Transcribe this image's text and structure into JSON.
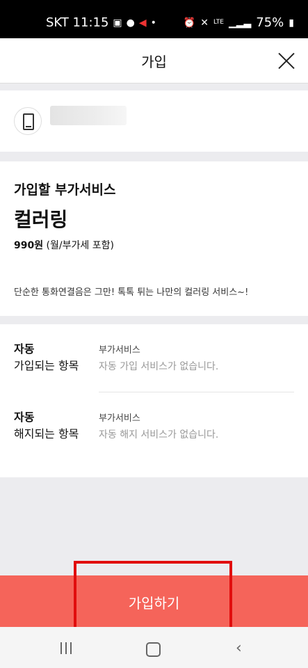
{
  "status_bar": {
    "carrier_time": "SKT 11:15",
    "notification_icons": [
      "image-icon",
      "talk-icon",
      "megaphone-icon"
    ],
    "dot": "•",
    "right_icons": [
      "alarm-icon",
      "mute-icon",
      "lte-icon",
      "signal-icon"
    ],
    "lte": "LTE",
    "battery": "75%"
  },
  "header": {
    "title": "가입",
    "close_icon": "close-icon"
  },
  "phone_card": {
    "icon": "phone-icon"
  },
  "service": {
    "label": "가입할 부가서비스",
    "name": "컬러링",
    "price_amount": "990원",
    "price_note": " (월/부가세 포함)",
    "description": "단순한 통화연결음은 그만! 톡톡 튀는 나만의 컬러링 서비스~!"
  },
  "items": {
    "auto_join": {
      "title_line1": "자동",
      "title_line2": "가입되는 항목",
      "category": "부가서비스",
      "value": "자동 가입 서비스가 없습니다."
    },
    "auto_cancel": {
      "title_line1": "자동",
      "title_line2": "해지되는 항목",
      "category": "부가서비스",
      "value": "자동 해지 서비스가 없습니다."
    }
  },
  "join_button": {
    "label": "가입하기",
    "color": "#f5645a"
  },
  "highlight": {
    "color": "#e10d0d"
  },
  "nav_bar": {
    "recent_icon": "recent-apps-icon",
    "home_icon": "home-icon",
    "back_icon": "back-icon",
    "back_glyph": "‹"
  }
}
